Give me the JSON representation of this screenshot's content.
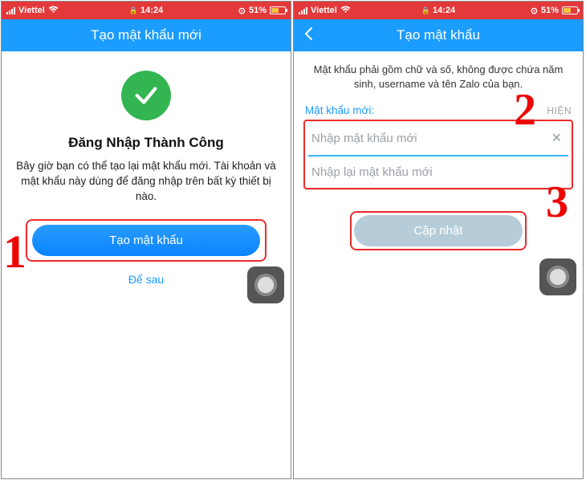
{
  "status_bar": {
    "carrier": "Viettel",
    "time": "14:24",
    "battery_percent": "51%"
  },
  "screen1": {
    "header_title": "Tạo mật khẩu mới",
    "success_title": "Đăng Nhập Thành Công",
    "success_desc": "Bây giờ bạn có thể tạo lại mật khẩu mới. Tài khoản và mật khẩu này dùng để đăng nhập trên bất kỳ thiết bị nào.",
    "create_btn": "Tạo mật khẩu",
    "later_link": "Để sau"
  },
  "screen2": {
    "header_title": "Tạo mật khẩu",
    "instruction": "Mật khẩu phải gồm chữ và số, không được chứa năm sinh, username và tên Zalo của bạn.",
    "field_label": "Mật khẩu mới:",
    "show_label": "HIỆN",
    "placeholder1": "Nhập mật khẩu mới",
    "placeholder2": "Nhập lại mật khẩu mới",
    "update_btn": "Cập nhật"
  },
  "annotations": {
    "one": "1",
    "two": "2",
    "three": "3"
  }
}
